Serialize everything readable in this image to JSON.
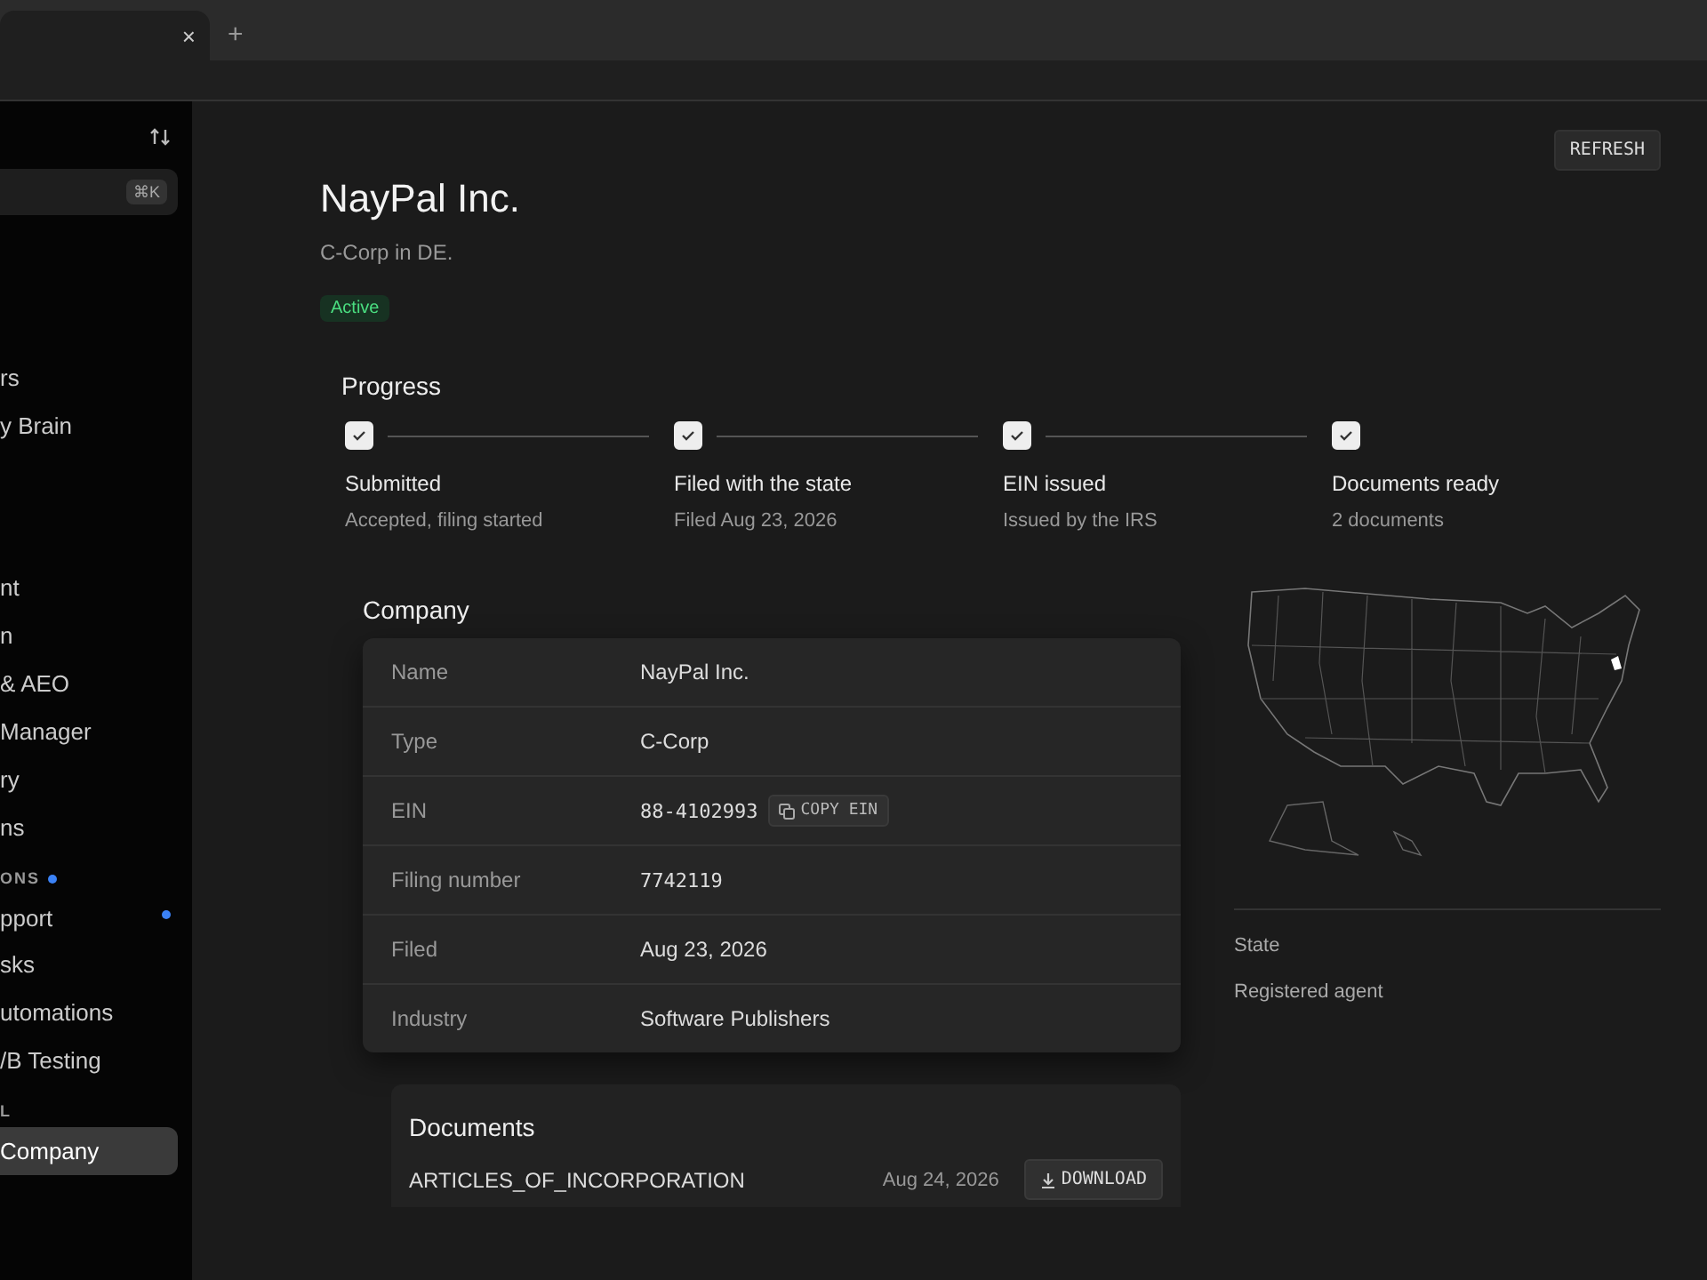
{
  "browser": {
    "tab_close": "×",
    "new_tab": "+"
  },
  "sidebar": {
    "shortcut": "⌘K",
    "items": [
      {
        "kind": "item",
        "label": "rs",
        "selected": false,
        "dot": false
      },
      {
        "kind": "item",
        "label": "y Brain",
        "selected": false,
        "dot": false
      },
      {
        "kind": "gap"
      },
      {
        "kind": "item",
        "label": "nt",
        "selected": false,
        "dot": false
      },
      {
        "kind": "item",
        "label": "n",
        "selected": false,
        "dot": false
      },
      {
        "kind": "item",
        "label": "& AEO",
        "selected": false,
        "dot": false
      },
      {
        "kind": "item",
        "label": "Manager",
        "selected": false,
        "dot": false
      },
      {
        "kind": "item",
        "label": "ry",
        "selected": false,
        "dot": false
      },
      {
        "kind": "item",
        "label": "ns",
        "selected": false,
        "dot": false
      },
      {
        "kind": "section",
        "label": "ONS",
        "dot": true
      },
      {
        "kind": "item",
        "label": "pport",
        "selected": false,
        "dot": true
      },
      {
        "kind": "item",
        "label": "sks",
        "selected": false,
        "dot": false
      },
      {
        "kind": "item",
        "label": "utomations",
        "selected": false,
        "dot": false
      },
      {
        "kind": "item",
        "label": "/B Testing",
        "selected": false,
        "dot": false
      },
      {
        "kind": "section",
        "label": "L",
        "dot": false
      },
      {
        "kind": "item",
        "label": "Company",
        "selected": true,
        "dot": false
      }
    ]
  },
  "header": {
    "title": "NayPal Inc.",
    "subtitle": "C-Corp in DE.",
    "status": "Active",
    "refresh": "REFRESH"
  },
  "progress": {
    "title": "Progress",
    "steps": [
      {
        "title": "Submitted",
        "detail": "Accepted, filing started",
        "done": true
      },
      {
        "title": "Filed with the state",
        "detail": "Filed Aug 23, 2026",
        "done": true
      },
      {
        "title": "EIN issued",
        "detail": "Issued by the IRS",
        "done": true
      },
      {
        "title": "Documents ready",
        "detail": "2 documents",
        "done": true
      }
    ]
  },
  "company": {
    "title": "Company",
    "rows": [
      {
        "label": "Name",
        "value": "NayPal Inc.",
        "kind": "text"
      },
      {
        "label": "Type",
        "value": "C-Corp",
        "kind": "text"
      },
      {
        "label": "EIN",
        "value": "88-4102993",
        "kind": "copy",
        "action": "COPY EIN"
      },
      {
        "label": "Filing number",
        "value": "7742119",
        "kind": "mono"
      },
      {
        "label": "Filed",
        "value": "Aug 23, 2026",
        "kind": "text"
      },
      {
        "label": "Industry",
        "value": "Software Publishers",
        "kind": "text"
      }
    ]
  },
  "location": {
    "rows": [
      "State",
      "Registered agent"
    ]
  },
  "documents": {
    "title": "Documents",
    "rows": [
      {
        "name": "ARTICLES_OF_INCORPORATION",
        "date": "Aug 24, 2026",
        "action": "DOWNLOAD"
      }
    ]
  }
}
